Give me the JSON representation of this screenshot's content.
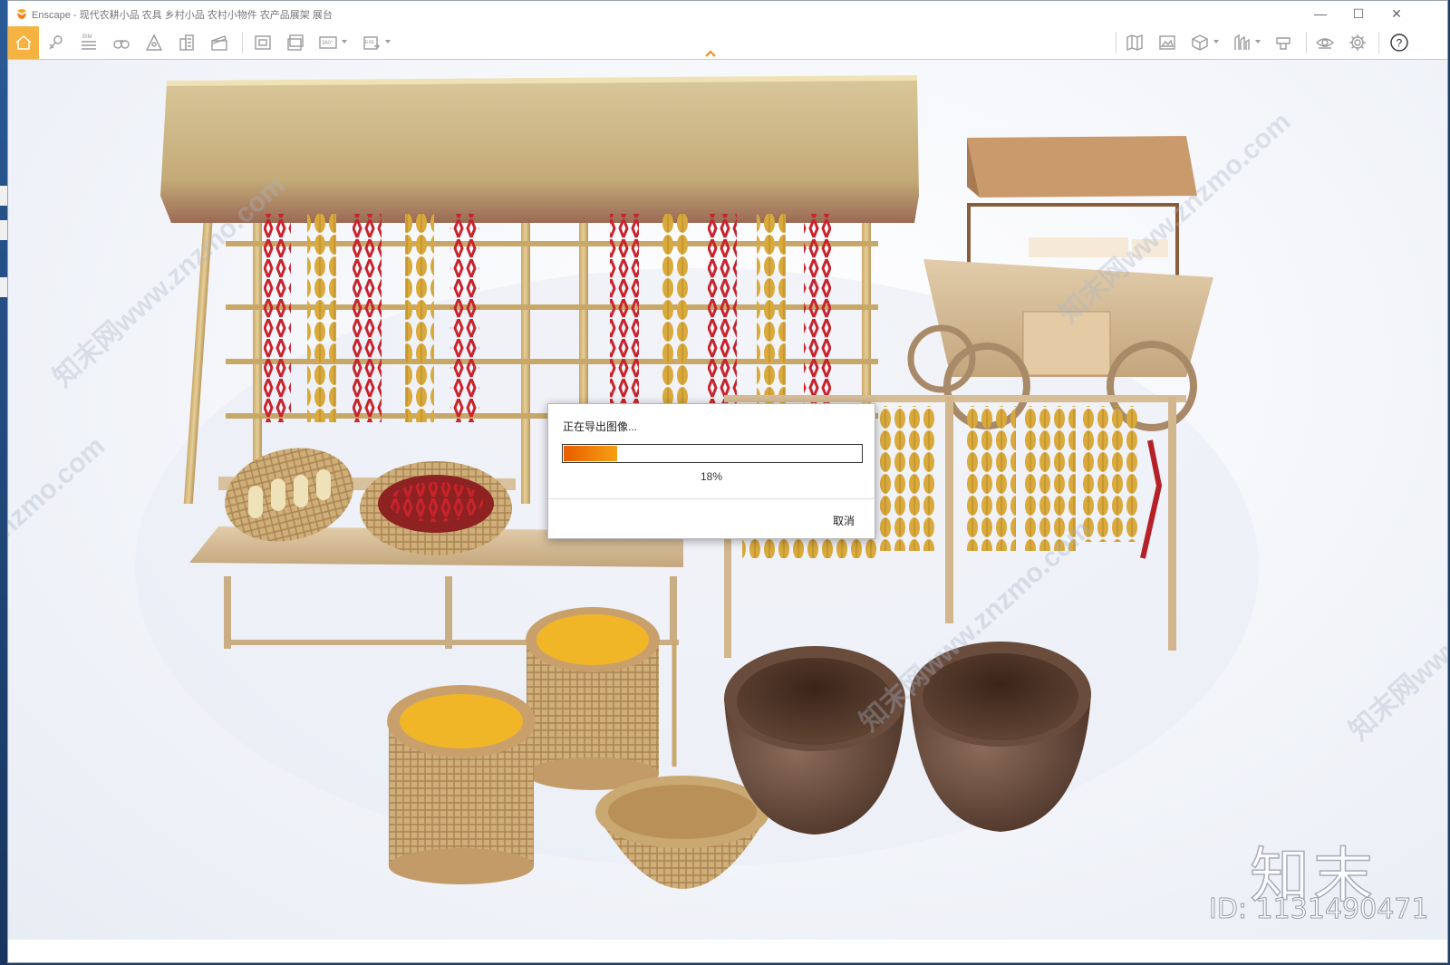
{
  "window": {
    "title": "Enscape - 现代农耕小品 农具 乡村小品 农村小物件 农产品展架 展台",
    "controls": {
      "minimize": "—",
      "maximize": "☐",
      "close": "✕"
    }
  },
  "toolbar": {
    "left_icons": [
      "home-icon",
      "pin-icon",
      "bim-icon",
      "binoculars-icon",
      "perspective-icon",
      "buildings-icon",
      "clapper-icon",
      "screenshot-icon",
      "batch-render-icon",
      "panorama-360-icon",
      "exe-export-icon"
    ],
    "right_icons": [
      "map-icon",
      "image-gallery-icon",
      "view-cube-icon",
      "asset-library-icon",
      "materials-icon",
      "visual-settings-icon",
      "settings-icon",
      "help-icon"
    ],
    "bim_label": "BIM",
    "pano_label": "360°",
    "exe_label": "EXE",
    "help_label": "?"
  },
  "dialog": {
    "title": "正在导出图像...",
    "progress": 0.18,
    "percent_label": "18%",
    "cancel_label": "取消"
  },
  "watermarks": {
    "brand": "知末",
    "id": "ID: 1131490471",
    "site": "知末网www.znzmo.com",
    "site_short": "znzmo.com"
  },
  "colors": {
    "accent": "#f5b342",
    "progress_start": "#e85d00",
    "progress_end": "#f6a012",
    "collapse_arrow": "#f08a1a"
  }
}
